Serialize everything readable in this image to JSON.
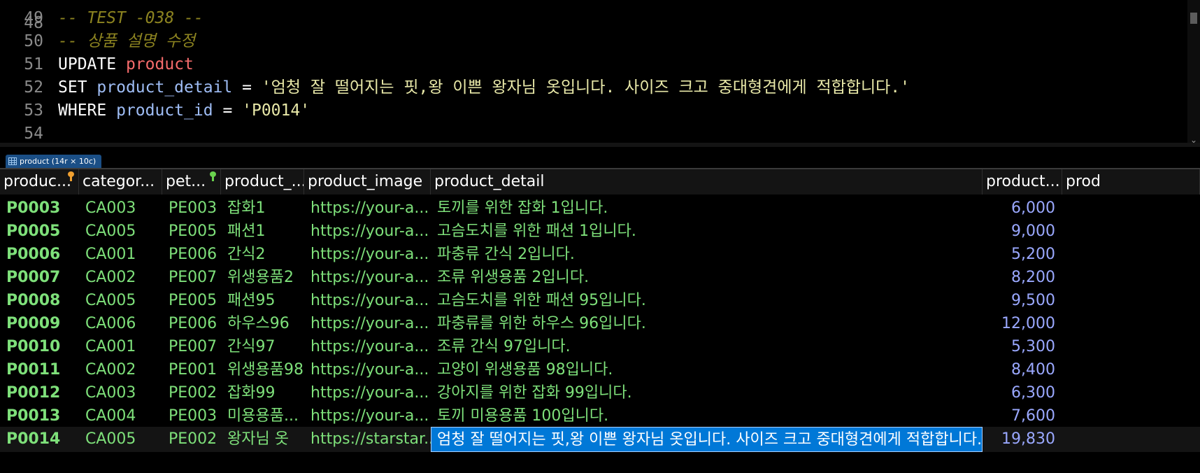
{
  "editor": {
    "lines": [
      {
        "no": "49",
        "parts": [
          {
            "t": "-- TEST -038 --",
            "c": "cmt"
          }
        ]
      },
      {
        "no": "50",
        "parts": [
          {
            "t": "-- 상품 설명 수정",
            "c": "cmt"
          }
        ]
      },
      {
        "no": "51",
        "parts": [
          {
            "t": "UPDATE",
            "c": "kw"
          },
          {
            "t": " ",
            "c": "op"
          },
          {
            "t": "product",
            "c": "tbl"
          }
        ]
      },
      {
        "no": "52",
        "parts": [
          {
            "t": "SET",
            "c": "kw"
          },
          {
            "t": " ",
            "c": "op"
          },
          {
            "t": "product_detail",
            "c": "col"
          },
          {
            "t": " = ",
            "c": "op"
          },
          {
            "t": "'엄청 잘 떨어지는 핏,왕 이쁜 왕자님 옷입니다. 사이즈 크고 중대형견에게 적합합니다.'",
            "c": "str"
          }
        ]
      },
      {
        "no": "53",
        "parts": [
          {
            "t": "WHERE",
            "c": "kw"
          },
          {
            "t": " ",
            "c": "op"
          },
          {
            "t": "product_id",
            "c": "col"
          },
          {
            "t": " = ",
            "c": "op"
          },
          {
            "t": "'P0014'",
            "c": "str"
          }
        ]
      },
      {
        "no": "54",
        "parts": []
      }
    ]
  },
  "result_tab": {
    "label": "product (14r × 10c)"
  },
  "grid": {
    "columns": [
      {
        "label": "produc...",
        "key": "pk"
      },
      {
        "label": "categor...",
        "key": ""
      },
      {
        "label": "pet...",
        "key": "fk"
      },
      {
        "label": "product_...",
        "key": ""
      },
      {
        "label": "product_image",
        "key": ""
      },
      {
        "label": "product_detail",
        "key": ""
      },
      {
        "label": "product...",
        "key": ""
      },
      {
        "label": "prod",
        "key": ""
      }
    ],
    "rows": [
      [
        "P0003",
        "CA003",
        "PE003",
        "잡화1",
        "https://your-a...",
        "토끼를 위한 잡화 1입니다.",
        "6,000"
      ],
      [
        "P0005",
        "CA005",
        "PE005",
        "패션1",
        "https://your-a...",
        "고슴도치를 위한 패션 1입니다.",
        "9,000"
      ],
      [
        "P0006",
        "CA001",
        "PE006",
        "간식2",
        "https://your-a...",
        "파충류 간식 2입니다.",
        "5,200"
      ],
      [
        "P0007",
        "CA002",
        "PE007",
        "위생용품2",
        "https://your-a...",
        "조류 위생용품 2입니다.",
        "8,200"
      ],
      [
        "P0008",
        "CA005",
        "PE005",
        "패션95",
        "https://your-a...",
        "고슴도치를 위한 패션 95입니다.",
        "9,500"
      ],
      [
        "P0009",
        "CA006",
        "PE006",
        "하우스96",
        "https://your-a...",
        "파충류를 위한 하우스 96입니다.",
        "12,000"
      ],
      [
        "P0010",
        "CA001",
        "PE007",
        "간식97",
        "https://your-a...",
        "조류 간식 97입니다.",
        "5,300"
      ],
      [
        "P0011",
        "CA002",
        "PE001",
        "위생용품98",
        "https://your-a...",
        "고양이 위생용품 98입니다.",
        "8,400"
      ],
      [
        "P0012",
        "CA003",
        "PE002",
        "잡화99",
        "https://your-a...",
        "강아지를 위한 잡화 99입니다.",
        "6,300"
      ],
      [
        "P0013",
        "CA004",
        "PE003",
        "미용용품...",
        "https://your-a...",
        "토끼 미용용품 100입니다.",
        "7,600"
      ],
      [
        "P0014",
        "CA005",
        "PE002",
        "왕자님 옷",
        "https://starstar...",
        "엄청 잘 떨어지는 핏,왕 이쁜 왕자님 옷입니다. 사이즈 크고 중대형견에게 적합합니다.",
        "19,830"
      ]
    ],
    "selected_row": 10,
    "editing_col": 5
  },
  "colors": {
    "accent": "#0078d7",
    "text_green": "#7ee07a",
    "number_blue": "#9aa8ff",
    "comment": "#8c8320"
  }
}
